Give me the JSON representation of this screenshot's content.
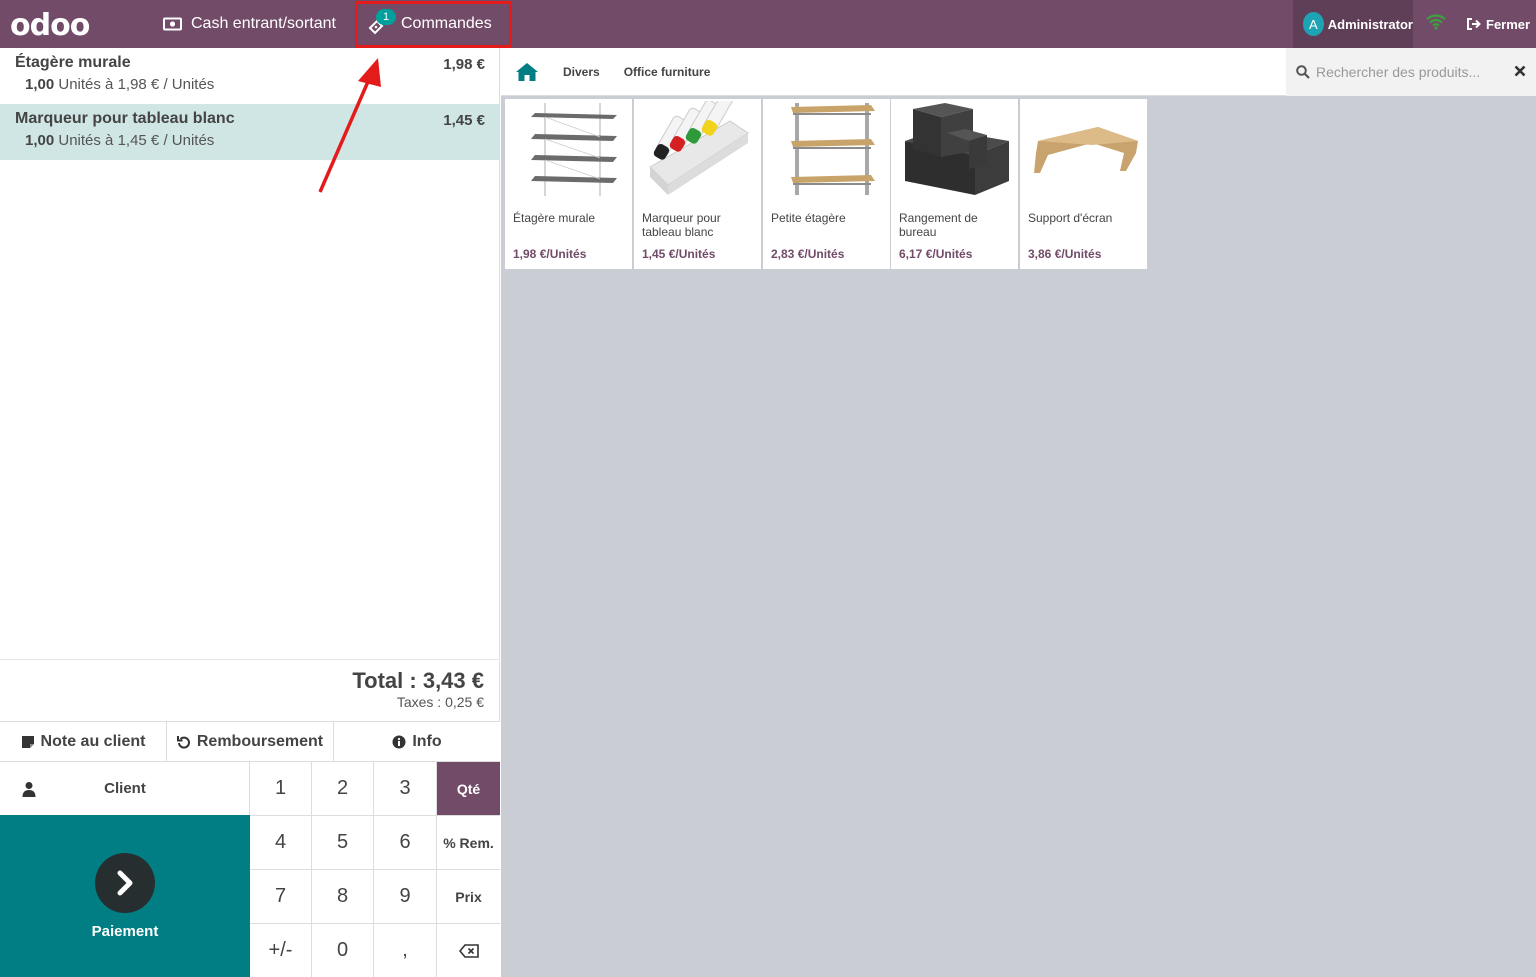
{
  "topbar": {
    "logo": "odoo",
    "cash_label": "Cash entrant/sortant",
    "orders_label": "Commandes",
    "orders_badge": "1",
    "user_initial": "A",
    "user_name": "Administrator",
    "close_label": "Fermer"
  },
  "order": {
    "lines": [
      {
        "name": "Étagère murale",
        "price": "1,98 €",
        "qty": "1,00",
        "detail": "Unités à 1,98 € / Unités"
      },
      {
        "name": "Marqueur pour tableau blanc",
        "price": "1,45 €",
        "qty": "1,00",
        "detail": "Unités à 1,45 € / Unités"
      }
    ],
    "total": "Total : 3,43 €",
    "taxes": "Taxes : 0,25 €"
  },
  "controls": {
    "note_label": "Note au client",
    "refund_label": "Remboursement",
    "info_label": "Info",
    "client_label": "Client",
    "payment_label": "Paiement"
  },
  "numpad": {
    "keys": [
      "1",
      "2",
      "3",
      "Qté",
      "4",
      "5",
      "6",
      "% Rem.",
      "7",
      "8",
      "9",
      "Prix",
      "+/-",
      "0",
      ","
    ]
  },
  "categories": {
    "items": [
      "Divers",
      "Office furniture"
    ]
  },
  "search": {
    "placeholder": "Rechercher des produits..."
  },
  "products": [
    {
      "name": "Étagère murale",
      "price": "1,98 €/Unités"
    },
    {
      "name": "Marqueur pour tableau blanc",
      "price": "1,45 €/Unités"
    },
    {
      "name": "Petite étagère",
      "price": "2,83 €/Unités"
    },
    {
      "name": "Rangement de bureau",
      "price": "6,17 €/Unités"
    },
    {
      "name": "Support d'écran",
      "price": "3,86 €/Unités"
    }
  ],
  "colors": {
    "brand": "#714b67",
    "teal": "#017e84",
    "highlight": "#e31b1b",
    "selected_line": "#cfe6e4"
  }
}
